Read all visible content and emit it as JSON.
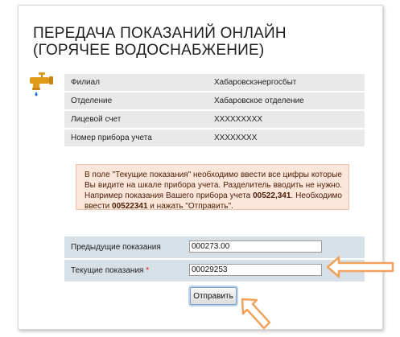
{
  "page": {
    "title_line1": "ПЕРЕДАЧА ПОКАЗАНИЙ ОНЛАЙН",
    "title_line2": "(ГОРЯЧЕЕ ВОДОСНАБЖЕНИЕ)"
  },
  "info": {
    "rows": [
      {
        "label": "Филиал",
        "value": "Хабаровскэнергосбыт"
      },
      {
        "label": "Отделение",
        "value": "Хабаровское отделение"
      },
      {
        "label": "Лицевой счет",
        "value": "XXXXXXXXX"
      },
      {
        "label": "Номер прибора учета",
        "value": "XXXXXXXX"
      }
    ]
  },
  "note": {
    "part1": "В поле \"Текущие показания\" необходимо ввести все цифры которые Вы видите на шкале прибора учета. Разделитель вводить не нужно. Например показания Вашего прибора учета ",
    "bold1": "00522,341",
    "part2": ". Необходимо ввести ",
    "bold2": "00522341",
    "part3": " и нажать \"Отправить\"."
  },
  "form": {
    "previous_label": "Предыдущие показания",
    "previous_value": "000273.00",
    "current_label": "Текущие показания",
    "required_mark": "*",
    "current_value": "00029253"
  },
  "buttons": {
    "submit_label": "Отправить"
  },
  "colors": {
    "annotation_arrow": "#f0a25a",
    "faucet": "#e09a1a",
    "drop": "#1f74c9"
  },
  "icons": {
    "faucet": "faucet-icon",
    "arrow_right": "annotation-arrow-left-icon",
    "arrow_up": "annotation-arrow-up-icon"
  }
}
